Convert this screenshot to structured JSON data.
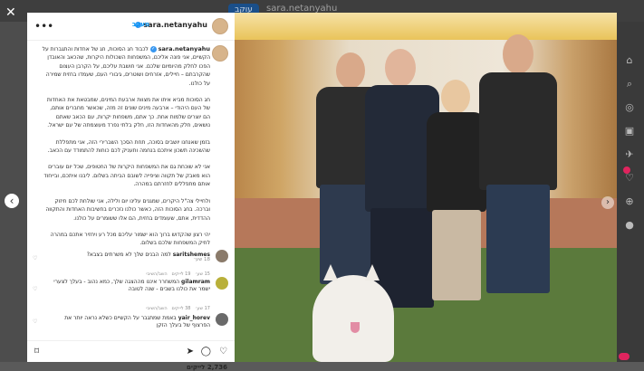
{
  "background": {
    "follow_label": "עוקב",
    "username": "sara.netanyahu"
  },
  "panel": {
    "header": {
      "username": "sara.netanyahu",
      "follow_label": "מעקב",
      "more_icon": "more-horizontal-icon"
    },
    "caption": {
      "username": "sara.netanyahu",
      "paragraphs": [
        "לכבוד חג הסוכות, חג של אחדות והתגברות על הקשיים, אני פונה אליכם, המשפחות השכולות היקרות, שהכאב והאובדן הפכו לחלק מהיומיום שלכם. אני חושבת עליכם, על הקרבן העצום שהקרבתם – חיילים, אזרחים ושוטרים, גיבורי העם, שעמדו בחזית שמירה על כולנו.",
        "חג הסוכות מביא איתו את מצוות ארבעת המינים, שמבטאת את האחדות של העם היהודי – ארבעה מינים שונים זה מזה, שכאשר מחברים אותם, הם יוצרים שלמות אחת. כך אתם, משפחות יקרות, עם הכאב שאתם נושאים, חלק מהאחדות הזו, חלק בלתי נפרד מעוצמתה של עם ישראל.",
        "בזמן שאנחנו יושבים בסוכה, תחת הסכך השברירי הזה, אני מתפללת שהשכינה תשכון איתכם בנחמה ותעניק לכם כוחות להתמודד עם הכאב.",
        "אני לא שוכחת גם את המשפחות היקרות של החטופים, שכל יום עוברים הוא מאבק של תקווה וציפייה לשובם הביתה בשלום. ליבנו איתכם, ובייחוד אותם מתפללים לחזרתם במהרה.",
        "ולחיילי צה\"ל היקרים, שמגנים עלינו יום ולילה, אני שולחת לכם חיזוק וברכה. בחג הסוכות הזה, כאשר כולנו נזכרים בחשיבות האחדות והתקווה ההדדית, אתם, שעומדים בחזית, הם אלו ששומרים על כולנו.",
        "יהי רצון שהקדוש ברוך הוא ישמור עליכם מכל רע ויחזיר אתכם במהרה לחיק המשפחות שלכם בשלום."
      ],
      "time": "18 שע׳"
    },
    "comments": [
      {
        "username": "saritshemes",
        "text": "למה הבנים שלך לא משרתים בצבא?",
        "time": "15 שע׳",
        "likes": "19 לייקים",
        "reply": "השב/השיבי"
      },
      {
        "username": "gilamram",
        "text": "המשחרר איננו מההצגה שלך, כמא נהוב - בעלך לצערי ישמר את כולנו בשבים - שנה לטובה",
        "time": "17 שע׳",
        "likes": "38 לייקים",
        "reply": "השב/השיבי"
      },
      {
        "username": "yair_horev",
        "text": "באמת שמתגבר על הקשיים כשלא נראה יותר את הפרצוף של בעלך הזקן",
        "time": "",
        "likes": "",
        "reply": ""
      }
    ],
    "likes_count": "2,736 לייקים"
  },
  "colors": {
    "link": "#0095f6",
    "verified": "#3897f0",
    "muted": "#8e8e8e",
    "notification": "#e0245e"
  },
  "right_rail": {
    "icons": [
      "home-icon",
      "search-icon",
      "explore-icon",
      "reels-icon",
      "messages-icon",
      "notifications-icon",
      "create-icon",
      "profile-icon"
    ]
  }
}
